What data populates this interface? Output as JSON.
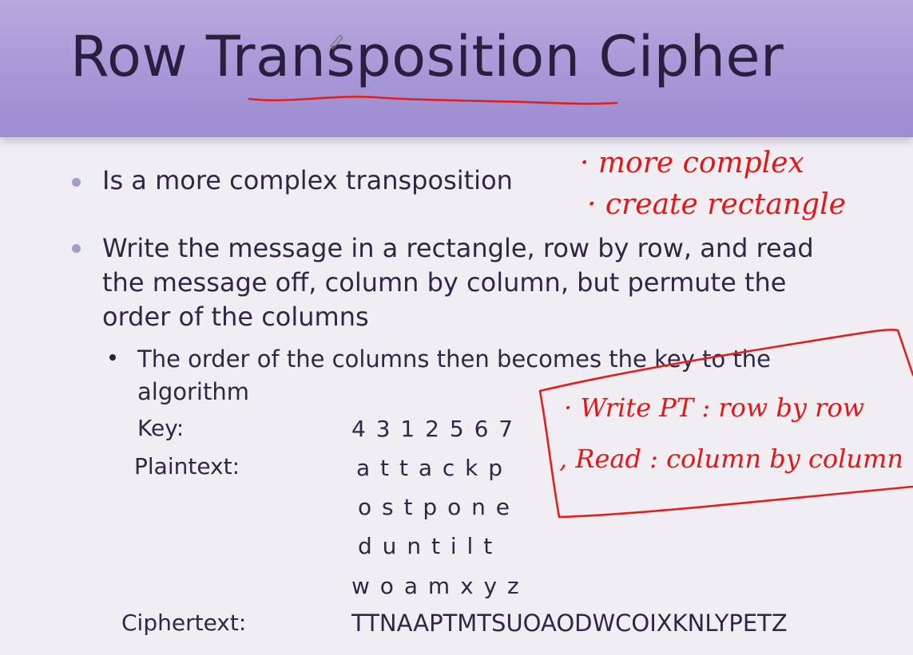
{
  "slide": {
    "title": "Row Transposition Cipher",
    "bullets": [
      "Is a more complex transposition",
      "Write the message in a rectangle, row by row, and read the message off, column by column, but permute the order of the columns"
    ],
    "bullet2_lines": [
      "Write the message in a rectangle, row by row, and read",
      "the message off, column by column, but permute the",
      "order of the columns"
    ],
    "sub_bullet_lines": [
      "The order of the columns then becomes the key to the",
      "algorithm"
    ],
    "key_label": "Key:",
    "key_value": "4 3 1 2 5 6 7",
    "plaintext_label": "Plaintext:",
    "plaintext_rows": [
      "a t t a c k p",
      "o s t p o n e",
      "d u n t i l t",
      "w o a m x y z"
    ],
    "ciphertext_label": "Ciphertext:",
    "ciphertext_value": "TTNAAPTMTSUOAODWCOIXKNLYPETZ"
  },
  "annotations": {
    "notes_top": [
      "· more complex",
      "· create rectangle"
    ],
    "notes_box": [
      "· Write PT : row by row",
      ", Read : column by column"
    ],
    "ink_color": "#e01818"
  },
  "colors": {
    "title_band": "#a797d8",
    "title_text": "#27203f",
    "bullet_dot": "#a998d2",
    "background": "#f1eef3"
  }
}
